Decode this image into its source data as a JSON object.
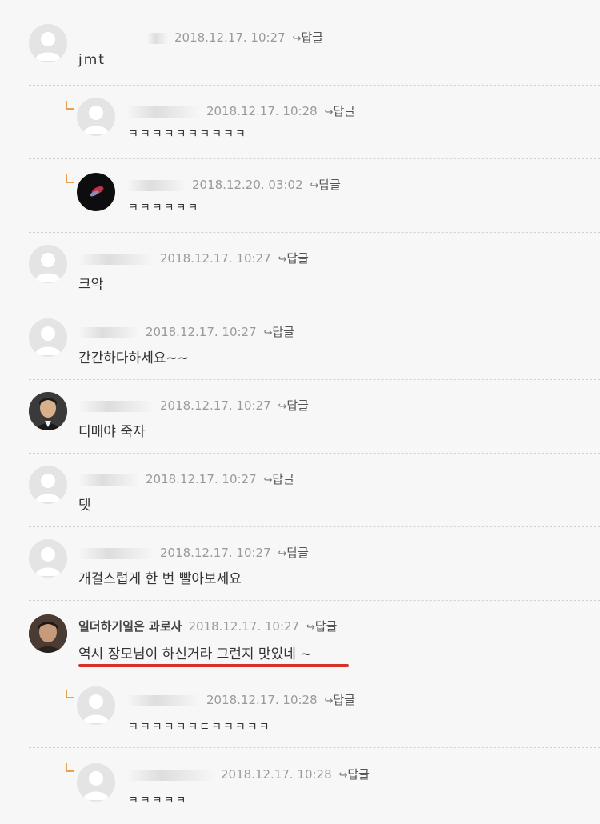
{
  "reply_label": "답글",
  "reply_arrow": "↪",
  "comments": [
    {
      "nickname": "",
      "date": "2018.12.17. 10:27",
      "text": "jmt",
      "avatar": "default-avatar",
      "reply": false
    },
    {
      "nickname": "",
      "date": "2018.12.17. 10:28",
      "text": "ㅋㅋㅋㅋㅋㅋㅋㅋㅋㅋ",
      "avatar": "default-avatar",
      "reply": true
    },
    {
      "nickname": "",
      "date": "2018.12.20. 03:02",
      "text": "ㅋㅋㅋㅋㅋㅋ",
      "avatar": "dark-logo-avatar",
      "reply": true
    },
    {
      "nickname": "",
      "date": "2018.12.17. 10:27",
      "text": "크악",
      "avatar": "default-avatar",
      "reply": false
    },
    {
      "nickname": "",
      "date": "2018.12.17. 10:27",
      "text": "간간하다하세요~~",
      "avatar": "default-avatar",
      "reply": false
    },
    {
      "nickname": "",
      "date": "2018.12.17. 10:27",
      "text": "디매야 죽자",
      "avatar": "person-photo-avatar",
      "reply": false
    },
    {
      "nickname": "",
      "date": "2018.12.17. 10:27",
      "text": "텟",
      "avatar": "default-avatar",
      "reply": false
    },
    {
      "nickname": "",
      "date": "2018.12.17. 10:27",
      "text": "개걸스럽게 한 번 빨아보세요",
      "avatar": "default-avatar",
      "reply": false
    },
    {
      "nickname": "일더하기일은 과로사",
      "date": "2018.12.17. 10:27",
      "text": "역시 장모님이 하신거라 그런지 맛있네 ~",
      "avatar": "person-photo-avatar",
      "reply": false,
      "highlighted": true
    },
    {
      "nickname": "",
      "date": "2018.12.17. 10:28",
      "text": "ㅋㅋㅋㅋㅋㅋㅌㅋㅋㅋㅋㅋ",
      "avatar": "default-avatar",
      "reply": true
    },
    {
      "nickname": "",
      "date": "2018.12.17. 10:28",
      "text": "ㅋㅋㅋㅋㅋ",
      "avatar": "default-avatar",
      "reply": true
    }
  ],
  "colors": {
    "background": "#f7f7f7",
    "reply_marker": "#e8a04a",
    "highlight_underline": "#d9302b",
    "meta_text": "#9a9a9a"
  }
}
